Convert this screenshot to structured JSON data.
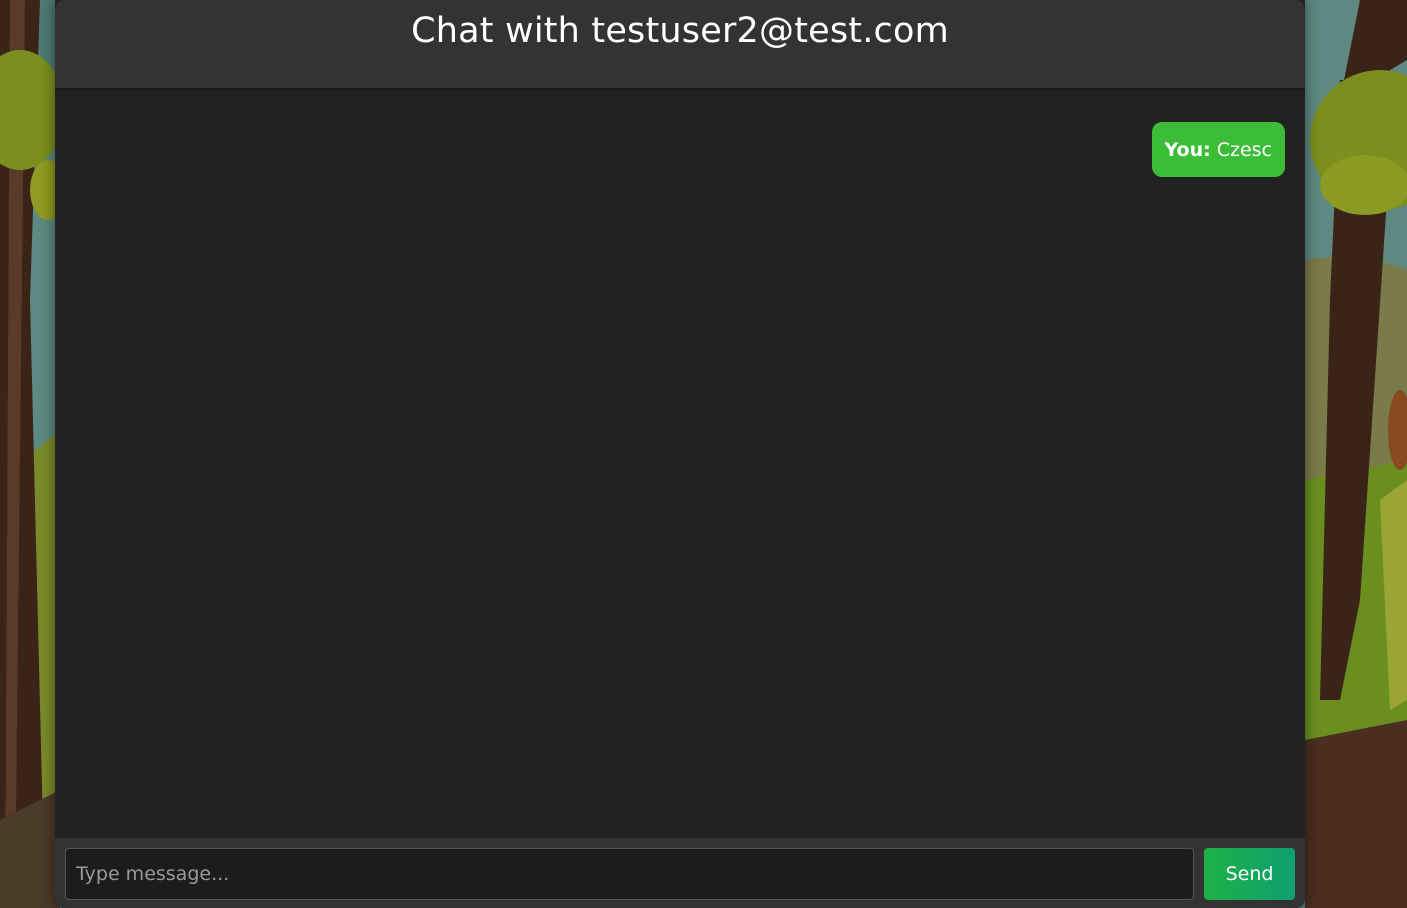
{
  "chat": {
    "title": "Chat with testuser2@test.com",
    "messages": [
      {
        "sender": "You:",
        "text": "Czesc",
        "bubble_color": "#3cbd37"
      }
    ]
  },
  "composer": {
    "placeholder": "Type message...",
    "send_label": "Send",
    "send_color": "#1fb146"
  },
  "theme": {
    "window_bg": "#222222",
    "header_bg": "#333333"
  }
}
